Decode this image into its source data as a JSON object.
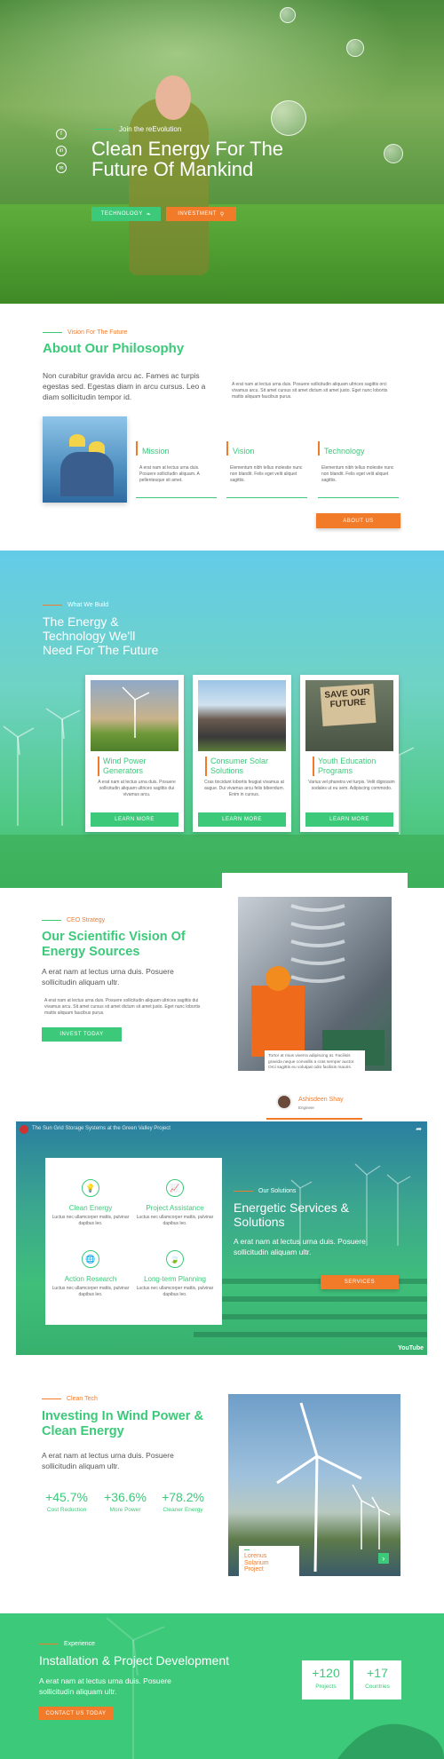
{
  "hero": {
    "kicker": "Join the reEvolution",
    "title_line1": "Clean Energy For The",
    "title_line2": "Future Of Mankind",
    "btn_technology": "TECHNOLOGY",
    "btn_investment": "INVESTMENT",
    "social": [
      "f",
      "in",
      "✉"
    ]
  },
  "philosophy": {
    "kicker": "Vision For The Future",
    "title": "About Our Philosophy",
    "lead": "Non curabitur gravida arcu ac. Fames ac turpis egestas sed. Egestas diam in arcu cursus. Leo a diam sollicitudin tempor id.",
    "side_text": "A erat nam at lectus urna duis. Posuere sollicitudin aliquam ultrices sagittis orci vivamus arcu. Sit amet cursus sit amet dictum sit amet justo. Eget nunc lobortis mattis aliquam faucibus purus.",
    "cards": [
      {
        "title": "Mission",
        "text": "A erat nam at lectus urna duis. Posuere sollicitudin aliquam. A pellentesque sit amet."
      },
      {
        "title": "Vision",
        "text": "Elementum nibh tellus molestie nunc non blandit. Felis eget velit aliquet sagittis."
      },
      {
        "title": "Technology",
        "text": "Elementum nibh tellus molestie nunc non blandit. Felis eget velit aliquet sagittis."
      }
    ],
    "btn": "ABOUT US"
  },
  "build": {
    "kicker": "What We Build",
    "title_line1": "The Energy &",
    "title_line2": "Technology We'll",
    "title_line3": "Need For The Future",
    "cards": [
      {
        "title": "Wind Power Generators",
        "text": "A erat nam at lectus urna duis. Posuere sollicitudin aliquam ultrices sagittis dui vivamus arcu.",
        "btn": "LEARN MORE"
      },
      {
        "title": "Consumer Solar Solutions",
        "text": "Cras tincidunt lobortis feugiat vivamus at augue. Dui vivamus arcu felis bibendum. Enim in cursus.",
        "btn": "LEARN MORE"
      },
      {
        "title": "Youth Education Programs",
        "text": "Varius vel pharetra vel turpis. Velit dignissim sodales ut eu sem. Adipiscing commodo.",
        "btn": "LEARN MORE"
      }
    ],
    "sign_text": "SAVE OUR FUTURE"
  },
  "vision": {
    "kicker": "CEO Strategy",
    "title_line1": "Our Scientific Vision Of",
    "title_line2": "Energy Sources",
    "lead": "A erat nam at lectus urna duis. Posuere sollicitudin aliquam ultr.",
    "text": "A erat nam at lectus urna duis. Posuere sollicitudin aliquam ultrices sagittis dui vivamus arcu. Sit amet cursus sit amet dictum sit amet justo. Eget nunc lobortis mattis aliquam faucibus purus.",
    "btn": "INVEST TODAY",
    "quote": "Tortor at risus viverra adipiscing at. Facilisis gravida neque convallis a cras semper auctor. Orci sagittis eu volutpat odio facilisis mauris.",
    "person_name": "Ashisdeen Shay",
    "person_role": "Engineer"
  },
  "video": {
    "title": "The Sun Grid Storage Systems at the Green Valley Project",
    "youtube": "YouTube",
    "features": [
      {
        "icon": "lightbulb-icon",
        "glyph": "💡",
        "title": "Clean Energy",
        "text": "Luctus nec ullamcorper mattis, pulvinar dapibus leo."
      },
      {
        "icon": "chart-icon",
        "glyph": "📈",
        "title": "Project Assistance",
        "text": "Luctus nec ullamcorper mattis, pulvinar dapibus leo."
      },
      {
        "icon": "globe-icon",
        "glyph": "🌐",
        "title": "Action Research",
        "text": "Luctus nec ullamcorper mattis, pulvinar dapibus leo."
      },
      {
        "icon": "leaf-icon",
        "glyph": "🍃",
        "title": "Long-term Planning",
        "text": "Luctus nec ullamcorper mattis, pulvinar dapibus leo."
      }
    ],
    "kicker": "Our Solutions",
    "heading_line1": "Energetic Services &",
    "heading_line2": "Solutions",
    "lead": "A erat nam at lectus urna duis. Posuere sollicitudin aliquam ultr.",
    "btn": "SERVICES"
  },
  "invest": {
    "kicker": "Clean Tech",
    "title_line1": "Investing In Wind Power &",
    "title_line2": "Clean Energy",
    "lead": "A erat nam at lectus urna duis. Posuere sollicitudin aliquam ultr.",
    "stats": [
      {
        "value": "+45.7%",
        "label": "Cost Reduction"
      },
      {
        "value": "+36.6%",
        "label": "More Power"
      },
      {
        "value": "+78.2%",
        "label": "Cleaner Energy"
      }
    ],
    "caption_line1": "Lorenus",
    "caption_line2": "Solarium",
    "caption_line3": "Project",
    "arrow": "›"
  },
  "install": {
    "kicker": "Experience",
    "title": "Installation & Project Development",
    "lead": "A erat nam at lectus urna duis. Posuere sollicitudin aliquam ultr.",
    "btn": "CONTACT US TODAY",
    "stats": [
      {
        "value": "+120",
        "label": "Projects"
      },
      {
        "value": "+17",
        "label": "Countries"
      }
    ]
  },
  "colors": {
    "green": "#3cc97a",
    "orange": "#f27b2a"
  }
}
